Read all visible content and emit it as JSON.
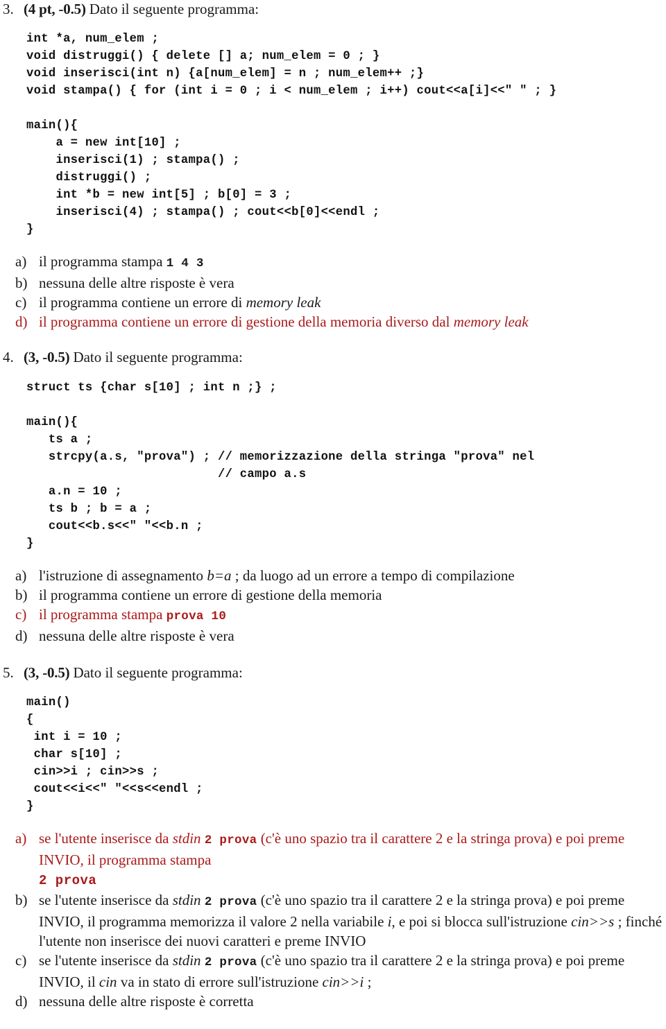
{
  "document": {
    "type": "exam-questions",
    "language": "it",
    "accent_red": "#aa1a1a",
    "text_color": "#1a1a1a"
  },
  "questions": [
    {
      "number": "3.",
      "points": "(4 pt, -0.5)",
      "prompt": "Dato il seguente programma:",
      "code_lines": [
        "int *a, num_elem ;",
        "void distruggi() { delete [] a; num_elem = 0 ; }",
        "void inserisci(int n) {a[num_elem] = n ; num_elem++ ;}",
        "void stampa() { for (int i = 0 ; i < num_elem ; i++) cout<<a[i]<<\" \" ; }",
        "",
        "main(){",
        "    a = new int[10] ;",
        "    inserisci(1) ; stampa() ;",
        "    distruggi() ;",
        "    int *b = new int[5] ; b[0] = 3 ;",
        "    inserisci(4) ; stampa() ; cout<<b[0]<<endl ;",
        "}"
      ],
      "answers": [
        {
          "letter": "a)",
          "red": false,
          "parts": [
            {
              "t": "il programma stampa ",
              "s": "plain"
            },
            {
              "t": "1  4  3",
              "s": "mono"
            }
          ]
        },
        {
          "letter": "b)",
          "red": false,
          "parts": [
            {
              "t": "nessuna delle altre risposte è vera",
              "s": "plain"
            }
          ]
        },
        {
          "letter": "c)",
          "red": false,
          "parts": [
            {
              "t": "il programma contiene un errore di ",
              "s": "plain"
            },
            {
              "t": "memory leak",
              "s": "italic"
            }
          ]
        },
        {
          "letter": "d)",
          "red": true,
          "parts": [
            {
              "t": "il programma contiene un errore di gestione della memoria diverso dal ",
              "s": "plain"
            },
            {
              "t": "memory leak",
              "s": "italic"
            }
          ]
        }
      ]
    },
    {
      "number": "4.",
      "points": "(3, -0.5)",
      "prompt": "Dato il seguente programma:",
      "code_lines": [
        "struct ts {char s[10] ; int n ;} ;",
        "",
        "main(){",
        "   ts a ;",
        "   strcpy(a.s, \"prova\") ; // memorizzazione della stringa \"prova\" nel",
        "                          // campo a.s",
        "   a.n = 10 ;",
        "   ts b ; b = a ;",
        "   cout<<b.s<<\" \"<<b.n ;",
        "}"
      ],
      "answers": [
        {
          "letter": "a)",
          "red": false,
          "parts": [
            {
              "t": "l'istruzione di assegnamento ",
              "s": "plain"
            },
            {
              "t": "b=a",
              "s": "italic"
            },
            {
              "t": " ; da luogo ad un errore a tempo di compilazione",
              "s": "plain"
            }
          ]
        },
        {
          "letter": "b)",
          "red": false,
          "parts": [
            {
              "t": "il programma contiene un errore di gestione della memoria",
              "s": "plain"
            }
          ]
        },
        {
          "letter": "c)",
          "red": true,
          "parts": [
            {
              "t": "il programma stampa ",
              "s": "plain"
            },
            {
              "t": "prova 10",
              "s": "mono"
            }
          ]
        },
        {
          "letter": "d)",
          "red": false,
          "parts": [
            {
              "t": "nessuna delle altre risposte è vera",
              "s": "plain"
            }
          ]
        }
      ]
    },
    {
      "number": "5.",
      "points": "(3, -0.5)",
      "prompt": "Dato il seguente programma:",
      "code_lines": [
        "main()",
        "{",
        " int i = 10 ;",
        " char s[10] ;",
        " cin>>i ; cin>>s ;",
        " cout<<i<<\" \"<<s<<endl ;",
        "}"
      ],
      "answers": [
        {
          "letter": "a)",
          "red": true,
          "parts": [
            {
              "t": "se l'utente inserisce da ",
              "s": "plain"
            },
            {
              "t": "stdin",
              "s": "italic"
            },
            {
              "t": " ",
              "s": "plain"
            },
            {
              "t": "2  prova",
              "s": "mono"
            },
            {
              "t": " (c'è uno spazio tra il carattere 2 e la stringa prova) e poi preme INVIO, il programma stampa",
              "s": "plain"
            },
            {
              "t": "\n",
              "s": "break"
            },
            {
              "t": "2 prova",
              "s": "mono-big"
            }
          ]
        },
        {
          "letter": "b)",
          "red": false,
          "parts": [
            {
              "t": "se l'utente inserisce da ",
              "s": "plain"
            },
            {
              "t": "stdin",
              "s": "italic"
            },
            {
              "t": " ",
              "s": "plain"
            },
            {
              "t": "2  prova",
              "s": "mono"
            },
            {
              "t": " (c'è uno spazio tra il carattere 2 e la stringa prova) e poi preme INVIO, il programma memorizza il valore 2 nella variabile ",
              "s": "plain"
            },
            {
              "t": "i",
              "s": "italic"
            },
            {
              "t": ", e poi si blocca sull'istruzione ",
              "s": "plain"
            },
            {
              "t": "cin>>s",
              "s": "italic"
            },
            {
              "t": " ; finché l'utente non inserisce dei nuovi caratteri e preme INVIO",
              "s": "plain"
            }
          ]
        },
        {
          "letter": "c)",
          "red": false,
          "parts": [
            {
              "t": "se l'utente inserisce da ",
              "s": "plain"
            },
            {
              "t": "stdin",
              "s": "italic"
            },
            {
              "t": " ",
              "s": "plain"
            },
            {
              "t": "2  prova",
              "s": "mono"
            },
            {
              "t": " (c'è uno spazio tra il carattere 2 e la stringa prova) e poi preme INVIO, il ",
              "s": "plain"
            },
            {
              "t": "cin",
              "s": "italic"
            },
            {
              "t": " va in stato di errore sull'istruzione ",
              "s": "plain"
            },
            {
              "t": "cin>>i",
              "s": "italic"
            },
            {
              "t": " ;",
              "s": "plain"
            }
          ]
        },
        {
          "letter": "d)",
          "red": false,
          "parts": [
            {
              "t": "nessuna delle altre risposte è corretta",
              "s": "plain"
            }
          ]
        }
      ]
    }
  ]
}
